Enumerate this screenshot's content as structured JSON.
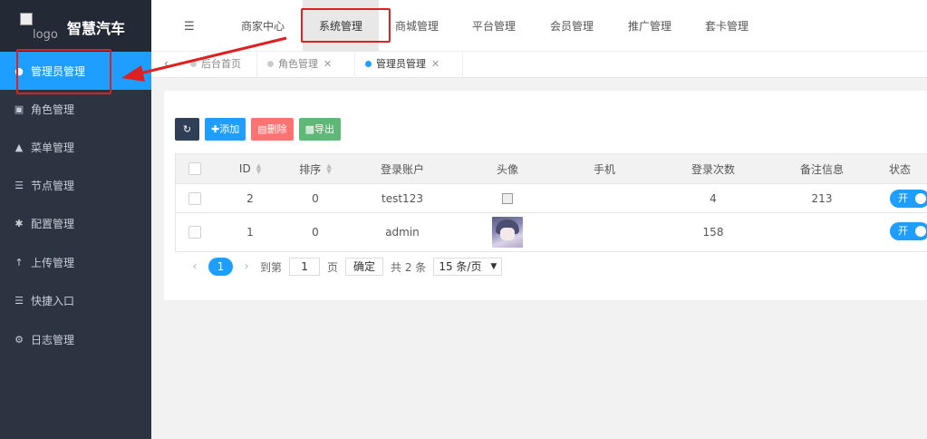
{
  "app": {
    "logo_alt": "logo",
    "title": "智慧汽车"
  },
  "sidebar": {
    "items": [
      {
        "label": "管理员管理",
        "icon": "user-icon",
        "active": true
      },
      {
        "label": "角色管理",
        "icon": "role-icon",
        "active": false
      },
      {
        "label": "菜单管理",
        "icon": "tree-icon",
        "active": false
      },
      {
        "label": "节点管理",
        "icon": "list-icon",
        "active": false
      },
      {
        "label": "配置管理",
        "icon": "asterisk-icon",
        "active": false
      },
      {
        "label": "上传管理",
        "icon": "upload-icon",
        "active": false
      },
      {
        "label": "快捷入口",
        "icon": "list-icon",
        "active": false
      },
      {
        "label": "日志管理",
        "icon": "log-icon",
        "active": false
      }
    ]
  },
  "topnav": {
    "tabs": [
      {
        "label": "商家中心",
        "active": false
      },
      {
        "label": "系统管理",
        "active": true
      },
      {
        "label": "商城管理",
        "active": false
      },
      {
        "label": "平台管理",
        "active": false
      },
      {
        "label": "会员管理",
        "active": false
      },
      {
        "label": "推广管理",
        "active": false
      },
      {
        "label": "套卡管理",
        "active": false
      }
    ]
  },
  "page_tabs": [
    {
      "label": "后台首页",
      "closable": false,
      "active": false
    },
    {
      "label": "角色管理",
      "closable": true,
      "active": false
    },
    {
      "label": "管理员管理",
      "closable": true,
      "active": true
    }
  ],
  "toolbar": {
    "add_label": "添加",
    "delete_label": "删除",
    "export_label": "导出"
  },
  "table": {
    "headers": [
      "ID",
      "排序",
      "登录账户",
      "头像",
      "手机",
      "登录次数",
      "备注信息",
      "状态"
    ],
    "rows": [
      {
        "id": "2",
        "sort": "0",
        "account": "test123",
        "avatar": "broken",
        "phone": "",
        "login_count": "4",
        "remark": "213",
        "status": "开"
      },
      {
        "id": "1",
        "sort": "0",
        "account": "admin",
        "avatar": "photo",
        "phone": "",
        "login_count": "158",
        "remark": "",
        "status": "开"
      }
    ]
  },
  "pager": {
    "current": "1",
    "goto_prefix": "到第",
    "goto_value": "1",
    "goto_suffix": "页",
    "confirm": "确定",
    "total": "共 2 条",
    "page_size": "15 条/页"
  },
  "colors": {
    "accent": "#1e9fff",
    "sidebar_bg": "#2c3442",
    "annotation": "#e02020"
  }
}
